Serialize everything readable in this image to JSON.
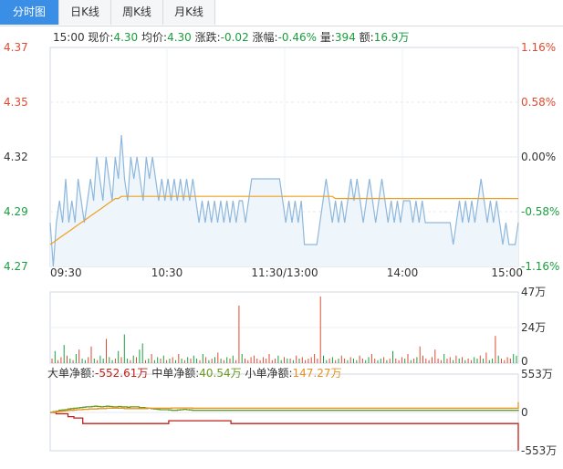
{
  "tabs": [
    {
      "label": "分时图",
      "active": true
    },
    {
      "label": "日K线",
      "active": false
    },
    {
      "label": "周K线",
      "active": false
    },
    {
      "label": "月K线",
      "active": false
    }
  ],
  "info": {
    "time": "15:00",
    "price_label": "现价:",
    "price": "4.30",
    "avg_label": "均价:",
    "avg": "4.30",
    "change_label": "涨跌:",
    "change": "-0.02",
    "pct_label": "涨幅:",
    "pct": "-0.46%",
    "vol_label": "量:",
    "vol": "394",
    "amt_label": "额:",
    "amt": "16.9万"
  },
  "flow": {
    "big_label": "大单净额:",
    "big": "-552.61万",
    "mid_label": "中单净额:",
    "mid": "40.54万",
    "small_label": "小单净额:",
    "small": "147.27万"
  },
  "colors": {
    "up": "#e04a30",
    "down": "#1a9e3e",
    "price_line": "#8fb8dc",
    "price_fill": "#eef6fc",
    "avg_line": "#f0a020",
    "big_line": "#c0201a",
    "mid_line": "#6a9a20",
    "small_line": "#e89020"
  },
  "chart_data": [
    {
      "type": "line",
      "name": "intraday-price",
      "yticks_left": [
        "4.37",
        "4.35",
        "4.32",
        "4.29",
        "4.27"
      ],
      "yticks_right": [
        "1.16%",
        "0.58%",
        "0.00%",
        "-0.58%",
        "-1.16%"
      ],
      "xticks": [
        "09:30",
        "10:30",
        "11:30/13:00",
        "14:00",
        "15:00"
      ],
      "ylim": [
        4.27,
        4.37
      ],
      "prev_close": 4.32,
      "price": [
        4.29,
        4.27,
        4.29,
        4.3,
        4.29,
        4.31,
        4.29,
        4.3,
        4.29,
        4.31,
        4.3,
        4.29,
        4.3,
        4.31,
        4.3,
        4.32,
        4.31,
        4.3,
        4.32,
        4.31,
        4.3,
        4.32,
        4.31,
        4.33,
        4.31,
        4.3,
        4.32,
        4.31,
        4.32,
        4.31,
        4.3,
        4.32,
        4.31,
        4.32,
        4.31,
        4.3,
        4.31,
        4.3,
        4.31,
        4.3,
        4.31,
        4.3,
        4.31,
        4.3,
        4.31,
        4.3,
        4.31,
        4.3,
        4.29,
        4.3,
        4.29,
        4.3,
        4.29,
        4.3,
        4.29,
        4.3,
        4.29,
        4.3,
        4.29,
        4.3,
        4.29,
        4.3,
        4.3,
        4.29,
        4.3,
        4.31,
        4.31,
        4.31,
        4.31,
        4.31,
        4.31,
        4.31,
        4.31,
        4.31,
        4.31,
        4.3,
        4.29,
        4.3,
        4.29,
        4.3,
        4.29,
        4.3,
        4.28,
        4.28,
        4.28,
        4.28,
        4.28,
        4.29,
        4.3,
        4.31,
        4.3,
        4.29,
        4.3,
        4.29,
        4.3,
        4.29,
        4.3,
        4.31,
        4.3,
        4.31,
        4.3,
        4.29,
        4.3,
        4.31,
        4.3,
        4.29,
        4.3,
        4.31,
        4.3,
        4.29,
        4.3,
        4.29,
        4.3,
        4.29,
        4.3,
        4.3,
        4.3,
        4.29,
        4.3,
        4.29,
        4.3,
        4.29,
        4.29,
        4.29,
        4.29,
        4.29,
        4.29,
        4.29,
        4.29,
        4.29,
        4.28,
        4.29,
        4.3,
        4.29,
        4.3,
        4.29,
        4.3,
        4.29,
        4.3,
        4.31,
        4.3,
        4.29,
        4.3,
        4.29,
        4.3,
        4.29,
        4.28,
        4.29,
        4.28,
        4.28,
        4.28,
        4.29
      ],
      "avg": [
        4.28,
        4.281,
        4.282,
        4.283,
        4.284,
        4.285,
        4.286,
        4.287,
        4.288,
        4.289,
        4.29,
        4.291,
        4.292,
        4.293,
        4.294,
        4.295,
        4.296,
        4.297,
        4.298,
        4.299,
        4.3,
        4.301,
        4.301,
        4.302,
        4.302,
        4.302,
        4.302,
        4.302,
        4.302,
        4.302,
        4.302,
        4.302,
        4.302,
        4.302,
        4.302,
        4.302,
        4.302,
        4.302,
        4.302,
        4.302,
        4.302,
        4.302,
        4.302,
        4.302,
        4.302,
        4.302,
        4.302,
        4.302,
        4.302,
        4.302,
        4.302,
        4.302,
        4.302,
        4.302,
        4.302,
        4.302,
        4.302,
        4.302,
        4.302,
        4.302,
        4.302,
        4.302,
        4.302,
        4.302,
        4.302,
        4.302,
        4.302,
        4.302,
        4.302,
        4.302,
        4.302,
        4.302,
        4.302,
        4.302,
        4.302,
        4.302,
        4.302,
        4.302,
        4.302,
        4.302,
        4.302,
        4.302,
        4.302,
        4.302,
        4.302,
        4.302,
        4.302,
        4.302,
        4.302,
        4.302,
        4.302,
        4.302,
        4.301,
        4.301,
        4.301,
        4.301,
        4.301,
        4.301,
        4.301,
        4.301,
        4.301,
        4.301,
        4.301,
        4.301,
        4.301,
        4.301,
        4.301,
        4.301,
        4.301,
        4.301,
        4.301,
        4.301,
        4.301,
        4.301,
        4.301,
        4.301,
        4.301,
        4.301,
        4.301,
        4.301,
        4.301,
        4.301,
        4.301,
        4.301,
        4.301,
        4.301,
        4.301,
        4.301,
        4.301,
        4.301,
        4.301,
        4.301,
        4.301,
        4.301,
        4.301,
        4.301,
        4.301,
        4.301,
        4.301,
        4.301,
        4.301,
        4.301,
        4.301,
        4.301,
        4.301,
        4.301,
        4.301,
        4.301,
        4.301,
        4.301,
        4.301,
        4.301
      ]
    },
    {
      "type": "bar",
      "name": "volume",
      "yticks": [
        "47万",
        "24万",
        "0"
      ],
      "ylim": [
        0,
        47
      ],
      "values": [
        3,
        8,
        2,
        4,
        12,
        5,
        3,
        2,
        6,
        9,
        3,
        2,
        4,
        11,
        3,
        2,
        5,
        3,
        16,
        4,
        2,
        3,
        8,
        4,
        19,
        3,
        2,
        5,
        4,
        9,
        13,
        2,
        3,
        6,
        2,
        4,
        3,
        5,
        2,
        3,
        4,
        2,
        6,
        3,
        2,
        4,
        3,
        5,
        3,
        2,
        6,
        4,
        2,
        3,
        4,
        7,
        3,
        2,
        4,
        3,
        5,
        2,
        38,
        6,
        3,
        2,
        4,
        5,
        3,
        2,
        4,
        3,
        6,
        2,
        3,
        5,
        2,
        4,
        3,
        3,
        2,
        5,
        3,
        4,
        2,
        3,
        4,
        6,
        3,
        44,
        5,
        2,
        3,
        4,
        2,
        3,
        5,
        3,
        2,
        4,
        3,
        2,
        5,
        3,
        2,
        4,
        6,
        3,
        2,
        3,
        4,
        2,
        3,
        8,
        3,
        2,
        4,
        3,
        6,
        2,
        3,
        4,
        11,
        5,
        3,
        2,
        4,
        9,
        3,
        2,
        6,
        3,
        4,
        2,
        5,
        3,
        4,
        2,
        3,
        2,
        4,
        3,
        5,
        3,
        7,
        2,
        3,
        18,
        5,
        3,
        2,
        4,
        3,
        6,
        5
      ]
    },
    {
      "type": "line",
      "name": "net-flow",
      "yticks": [
        "553万",
        "0",
        "-553万"
      ],
      "ylim": [
        -553,
        553
      ],
      "series": [
        {
          "name": "大单净额",
          "values": [
            0,
            0,
            -20,
            -20,
            -20,
            -20,
            -60,
            -60,
            -80,
            -80,
            -80,
            -160,
            -160,
            -160,
            -160,
            -160,
            -160,
            -160,
            -160,
            -160,
            -160,
            -160,
            -160,
            -160,
            -160,
            -160,
            -160,
            -160,
            -160,
            -160,
            -160,
            -160,
            -160,
            -160,
            -160,
            -160,
            -160,
            -160,
            -160,
            -160,
            -120,
            -120,
            -120,
            -120,
            -120,
            -120,
            -120,
            -120,
            -120,
            -120,
            -120,
            -120,
            -120,
            -120,
            -120,
            -120,
            -120,
            -120,
            -120,
            -120,
            -120,
            -160,
            -160,
            -160,
            -160,
            -160,
            -160,
            -160,
            -160,
            -160,
            -160,
            -160,
            -160,
            -160,
            -160,
            -160,
            -160,
            -160,
            -160,
            -160,
            -160,
            -160,
            -160,
            -160,
            -160,
            -160,
            -160,
            -160,
            -160,
            -160,
            -160,
            -160,
            -160,
            -160,
            -160,
            -160,
            -160,
            -160,
            -160,
            -160,
            -160,
            -160,
            -160,
            -160,
            -160,
            -160,
            -160,
            -160,
            -160,
            -160,
            -160,
            -160,
            -160,
            -160,
            -160,
            -160,
            -160,
            -160,
            -160,
            -160,
            -160,
            -160,
            -160,
            -160,
            -160,
            -160,
            -160,
            -160,
            -160,
            -160,
            -160,
            -160,
            -160,
            -160,
            -160,
            -160,
            -160,
            -160,
            -160,
            -160,
            -160,
            -160,
            -160,
            -160,
            -160,
            -160,
            -160,
            -160,
            -160,
            -160,
            -160,
            -160,
            -160,
            -160,
            -160,
            -160,
            -160,
            -160,
            -552
          ]
        },
        {
          "name": "中单净额",
          "values": [
            0,
            10,
            20,
            30,
            35,
            40,
            50,
            55,
            60,
            65,
            70,
            75,
            80,
            80,
            85,
            90,
            85,
            80,
            85,
            90,
            85,
            80,
            80,
            85,
            80,
            80,
            75,
            80,
            80,
            80,
            70,
            70,
            65,
            60,
            55,
            50,
            45,
            40,
            40,
            40,
            35,
            30,
            30,
            35,
            40,
            45,
            40,
            35,
            30,
            30,
            30,
            30,
            30,
            30,
            30,
            30,
            30,
            30,
            30,
            30,
            30,
            30,
            30,
            30,
            30,
            30,
            30,
            30,
            30,
            30,
            30,
            30,
            30,
            30,
            30,
            30,
            30,
            30,
            30,
            30,
            30,
            30,
            30,
            30,
            30,
            30,
            30,
            30,
            30,
            30,
            30,
            30,
            30,
            30,
            30,
            30,
            30,
            30,
            30,
            30,
            30,
            30,
            30,
            30,
            30,
            30,
            30,
            30,
            30,
            30,
            30,
            30,
            30,
            30,
            30,
            30,
            30,
            30,
            30,
            30,
            30,
            30,
            30,
            30,
            30,
            30,
            30,
            30,
            30,
            30,
            30,
            30,
            30,
            30,
            30,
            30,
            30,
            30,
            30,
            30,
            30,
            30,
            30,
            30,
            30,
            30,
            30,
            30,
            30,
            30,
            30,
            30,
            30,
            30,
            30,
            30,
            30,
            30,
            40
          ]
        },
        {
          "name": "小单净额",
          "values": [
            0,
            5,
            10,
            15,
            20,
            25,
            30,
            30,
            35,
            40,
            40,
            45,
            45,
            50,
            50,
            50,
            55,
            55,
            55,
            60,
            60,
            60,
            60,
            60,
            60,
            55,
            55,
            55,
            55,
            55,
            55,
            55,
            55,
            60,
            60,
            60,
            60,
            60,
            60,
            60,
            60,
            65,
            65,
            65,
            65,
            65,
            65,
            65,
            60,
            60,
            60,
            60,
            60,
            60,
            60,
            60,
            60,
            60,
            60,
            60,
            60,
            60,
            60,
            60,
            60,
            60,
            60,
            60,
            60,
            60,
            60,
            60,
            60,
            60,
            60,
            60,
            60,
            60,
            60,
            60,
            60,
            60,
            60,
            60,
            60,
            60,
            60,
            60,
            60,
            60,
            60,
            60,
            60,
            60,
            60,
            60,
            60,
            60,
            60,
            60,
            60,
            60,
            60,
            60,
            60,
            60,
            60,
            60,
            60,
            60,
            60,
            60,
            60,
            60,
            60,
            60,
            60,
            60,
            60,
            60,
            60,
            60,
            60,
            60,
            60,
            60,
            60,
            60,
            60,
            60,
            60,
            60,
            60,
            60,
            60,
            60,
            60,
            60,
            60,
            60,
            60,
            60,
            60,
            60,
            60,
            60,
            60,
            60,
            60,
            60,
            60,
            60,
            60,
            60,
            60,
            60,
            60,
            60,
            147
          ]
        }
      ]
    }
  ]
}
